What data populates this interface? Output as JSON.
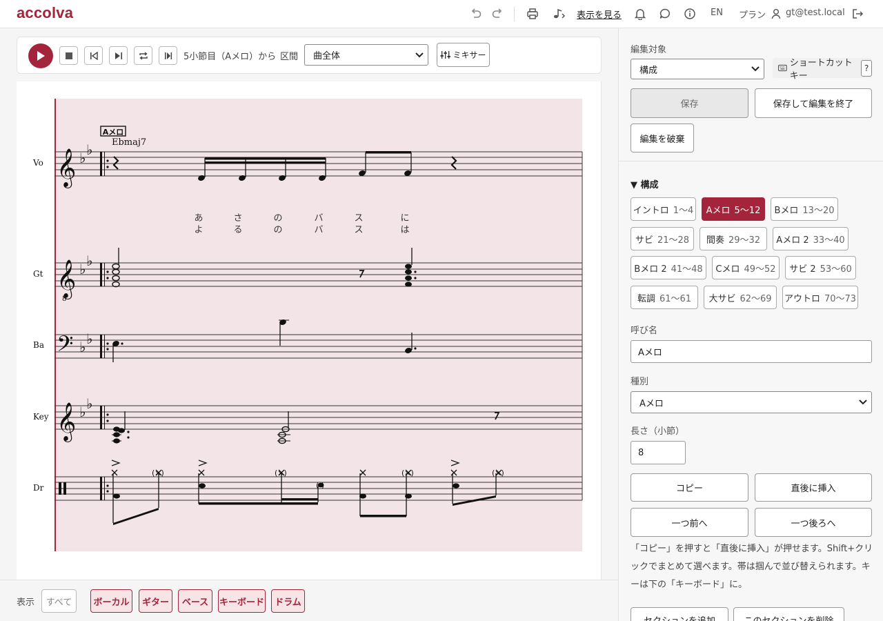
{
  "app": {
    "logo": "accolva"
  },
  "header": {
    "view_link": "表示を見る",
    "lang": "EN",
    "plan": "プラン",
    "user": "gt@test.local"
  },
  "transport": {
    "position": "5小節目（Aメロ）から",
    "range_label": "区間",
    "range_value": "曲全体",
    "mixer": "ミキサー"
  },
  "score": {
    "rehearsal_mark": "Aメロ",
    "chord": "Ebmaj7",
    "parts": [
      "Vo",
      "Gt",
      "Ba",
      "Key",
      "Dr"
    ],
    "lyrics_line1": [
      "あ",
      "さ",
      "の",
      "バ",
      "ス",
      "に"
    ],
    "lyrics_line2": [
      "よ",
      "る",
      "の",
      "バ",
      "ス",
      "は"
    ],
    "ghost_note": "(×)"
  },
  "filter": {
    "label": "表示",
    "all": "すべて",
    "chips": [
      "ボーカル",
      "ギター",
      "ベース",
      "キーボード",
      "ドラム"
    ]
  },
  "editor": {
    "target_label": "編集対象",
    "target_value": "構成",
    "shortcut": "ショートカットキー",
    "help_q": "?",
    "save": "保存",
    "save_exit": "保存して編集を終了",
    "discard": "編集を破棄",
    "structure_heading": "▼ 構成",
    "sections": [
      {
        "name": "イントロ",
        "range": "1〜4"
      },
      {
        "name": "Aメロ",
        "range": "5〜12"
      },
      {
        "name": "Bメロ",
        "range": "13〜20"
      },
      {
        "name": "サビ",
        "range": "21〜28"
      },
      {
        "name": "間奏",
        "range": "29〜32"
      },
      {
        "name": "Aメロ 2",
        "range": "33〜40"
      },
      {
        "name": "Bメロ 2",
        "range": "41〜48"
      },
      {
        "name": "Cメロ",
        "range": "49〜52"
      },
      {
        "name": "サビ 2",
        "range": "53〜60"
      },
      {
        "name": "転調",
        "range": "61〜61"
      },
      {
        "name": "大サビ",
        "range": "62〜69"
      },
      {
        "name": "アウトロ",
        "range": "70〜73"
      }
    ],
    "name_label": "呼び名",
    "name_value": "Aメロ",
    "kind_label": "種別",
    "kind_value": "Aメロ",
    "length_label": "長さ（小節）",
    "length_value": "8",
    "copy": "コピー",
    "insert_after": "直後に挿入",
    "move_prev": "一つ前へ",
    "move_next": "一つ後ろへ",
    "help_text": "「コピー」を押すと「直後に挿入」が押せます。Shift+クリックでまとめて選べます。帯は掴んで並び替えられます。キーは下の「キーボード」に。",
    "add_section": "セクションを追加",
    "delete_section": "このセクションを削除"
  },
  "colors": {
    "accent": "#a3243b",
    "band": "#f3e4e7"
  }
}
